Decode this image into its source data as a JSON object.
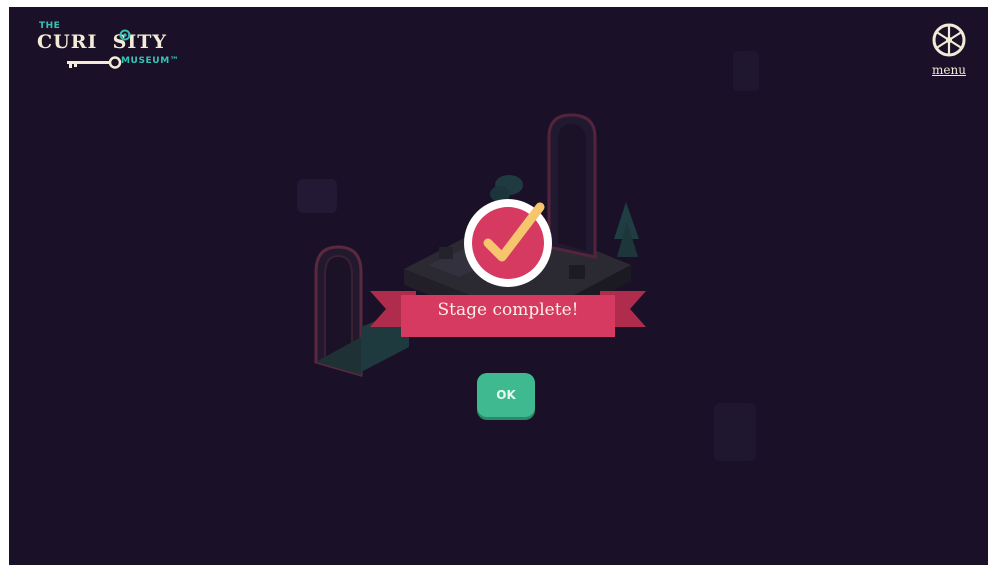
{
  "logo": {
    "the": "THE",
    "curiosity": "CURI  SITY",
    "museum": "MUSEUM™"
  },
  "menu": {
    "label": "menu",
    "icon": "wheel-icon"
  },
  "dialog": {
    "message": "Stage complete!",
    "ok_label": "OK",
    "badge_icon": "checkmark-icon"
  },
  "colors": {
    "background": "#1a1128",
    "ribbon": "#d63a60",
    "badge_ring": "#ffffff",
    "badge_fill": "#d63a60",
    "checkmark": "#f6c56e",
    "ok_button": "#3fb98f",
    "logo_teal": "#35c3b5",
    "logo_cream": "#f3ebd7"
  }
}
